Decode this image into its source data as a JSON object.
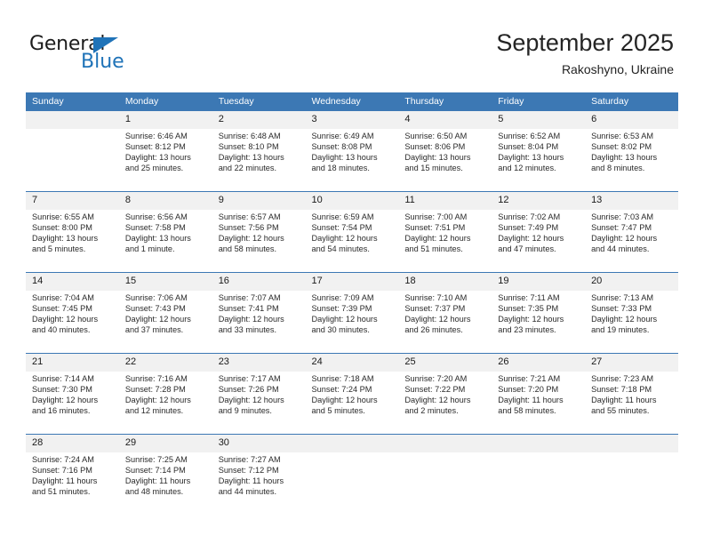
{
  "brand": {
    "name_dark": "General",
    "name_light": "Blue",
    "triangle_color": "#1f73b8",
    "logo_icon": "triangle-icon"
  },
  "header": {
    "title": "September 2025",
    "subtitle": "Rakoshyno, Ukraine",
    "accent_color": "#3c78b4",
    "num_band_color": "#f1f1f1"
  },
  "columns": [
    "Sunday",
    "Monday",
    "Tuesday",
    "Wednesday",
    "Thursday",
    "Friday",
    "Saturday"
  ],
  "weeks": [
    {
      "days": [
        {
          "num": "",
          "sunrise": "",
          "sunset": "",
          "daylight1": "",
          "daylight2": ""
        },
        {
          "num": "1",
          "sunrise": "Sunrise: 6:46 AM",
          "sunset": "Sunset: 8:12 PM",
          "daylight1": "Daylight: 13 hours",
          "daylight2": "and 25 minutes."
        },
        {
          "num": "2",
          "sunrise": "Sunrise: 6:48 AM",
          "sunset": "Sunset: 8:10 PM",
          "daylight1": "Daylight: 13 hours",
          "daylight2": "and 22 minutes."
        },
        {
          "num": "3",
          "sunrise": "Sunrise: 6:49 AM",
          "sunset": "Sunset: 8:08 PM",
          "daylight1": "Daylight: 13 hours",
          "daylight2": "and 18 minutes."
        },
        {
          "num": "4",
          "sunrise": "Sunrise: 6:50 AM",
          "sunset": "Sunset: 8:06 PM",
          "daylight1": "Daylight: 13 hours",
          "daylight2": "and 15 minutes."
        },
        {
          "num": "5",
          "sunrise": "Sunrise: 6:52 AM",
          "sunset": "Sunset: 8:04 PM",
          "daylight1": "Daylight: 13 hours",
          "daylight2": "and 12 minutes."
        },
        {
          "num": "6",
          "sunrise": "Sunrise: 6:53 AM",
          "sunset": "Sunset: 8:02 PM",
          "daylight1": "Daylight: 13 hours",
          "daylight2": "and 8 minutes."
        }
      ]
    },
    {
      "days": [
        {
          "num": "7",
          "sunrise": "Sunrise: 6:55 AM",
          "sunset": "Sunset: 8:00 PM",
          "daylight1": "Daylight: 13 hours",
          "daylight2": "and 5 minutes."
        },
        {
          "num": "8",
          "sunrise": "Sunrise: 6:56 AM",
          "sunset": "Sunset: 7:58 PM",
          "daylight1": "Daylight: 13 hours",
          "daylight2": "and 1 minute."
        },
        {
          "num": "9",
          "sunrise": "Sunrise: 6:57 AM",
          "sunset": "Sunset: 7:56 PM",
          "daylight1": "Daylight: 12 hours",
          "daylight2": "and 58 minutes."
        },
        {
          "num": "10",
          "sunrise": "Sunrise: 6:59 AM",
          "sunset": "Sunset: 7:54 PM",
          "daylight1": "Daylight: 12 hours",
          "daylight2": "and 54 minutes."
        },
        {
          "num": "11",
          "sunrise": "Sunrise: 7:00 AM",
          "sunset": "Sunset: 7:51 PM",
          "daylight1": "Daylight: 12 hours",
          "daylight2": "and 51 minutes."
        },
        {
          "num": "12",
          "sunrise": "Sunrise: 7:02 AM",
          "sunset": "Sunset: 7:49 PM",
          "daylight1": "Daylight: 12 hours",
          "daylight2": "and 47 minutes."
        },
        {
          "num": "13",
          "sunrise": "Sunrise: 7:03 AM",
          "sunset": "Sunset: 7:47 PM",
          "daylight1": "Daylight: 12 hours",
          "daylight2": "and 44 minutes."
        }
      ]
    },
    {
      "days": [
        {
          "num": "14",
          "sunrise": "Sunrise: 7:04 AM",
          "sunset": "Sunset: 7:45 PM",
          "daylight1": "Daylight: 12 hours",
          "daylight2": "and 40 minutes."
        },
        {
          "num": "15",
          "sunrise": "Sunrise: 7:06 AM",
          "sunset": "Sunset: 7:43 PM",
          "daylight1": "Daylight: 12 hours",
          "daylight2": "and 37 minutes."
        },
        {
          "num": "16",
          "sunrise": "Sunrise: 7:07 AM",
          "sunset": "Sunset: 7:41 PM",
          "daylight1": "Daylight: 12 hours",
          "daylight2": "and 33 minutes."
        },
        {
          "num": "17",
          "sunrise": "Sunrise: 7:09 AM",
          "sunset": "Sunset: 7:39 PM",
          "daylight1": "Daylight: 12 hours",
          "daylight2": "and 30 minutes."
        },
        {
          "num": "18",
          "sunrise": "Sunrise: 7:10 AM",
          "sunset": "Sunset: 7:37 PM",
          "daylight1": "Daylight: 12 hours",
          "daylight2": "and 26 minutes."
        },
        {
          "num": "19",
          "sunrise": "Sunrise: 7:11 AM",
          "sunset": "Sunset: 7:35 PM",
          "daylight1": "Daylight: 12 hours",
          "daylight2": "and 23 minutes."
        },
        {
          "num": "20",
          "sunrise": "Sunrise: 7:13 AM",
          "sunset": "Sunset: 7:33 PM",
          "daylight1": "Daylight: 12 hours",
          "daylight2": "and 19 minutes."
        }
      ]
    },
    {
      "days": [
        {
          "num": "21",
          "sunrise": "Sunrise: 7:14 AM",
          "sunset": "Sunset: 7:30 PM",
          "daylight1": "Daylight: 12 hours",
          "daylight2": "and 16 minutes."
        },
        {
          "num": "22",
          "sunrise": "Sunrise: 7:16 AM",
          "sunset": "Sunset: 7:28 PM",
          "daylight1": "Daylight: 12 hours",
          "daylight2": "and 12 minutes."
        },
        {
          "num": "23",
          "sunrise": "Sunrise: 7:17 AM",
          "sunset": "Sunset: 7:26 PM",
          "daylight1": "Daylight: 12 hours",
          "daylight2": "and 9 minutes."
        },
        {
          "num": "24",
          "sunrise": "Sunrise: 7:18 AM",
          "sunset": "Sunset: 7:24 PM",
          "daylight1": "Daylight: 12 hours",
          "daylight2": "and 5 minutes."
        },
        {
          "num": "25",
          "sunrise": "Sunrise: 7:20 AM",
          "sunset": "Sunset: 7:22 PM",
          "daylight1": "Daylight: 12 hours",
          "daylight2": "and 2 minutes."
        },
        {
          "num": "26",
          "sunrise": "Sunrise: 7:21 AM",
          "sunset": "Sunset: 7:20 PM",
          "daylight1": "Daylight: 11 hours",
          "daylight2": "and 58 minutes."
        },
        {
          "num": "27",
          "sunrise": "Sunrise: 7:23 AM",
          "sunset": "Sunset: 7:18 PM",
          "daylight1": "Daylight: 11 hours",
          "daylight2": "and 55 minutes."
        }
      ]
    },
    {
      "days": [
        {
          "num": "28",
          "sunrise": "Sunrise: 7:24 AM",
          "sunset": "Sunset: 7:16 PM",
          "daylight1": "Daylight: 11 hours",
          "daylight2": "and 51 minutes."
        },
        {
          "num": "29",
          "sunrise": "Sunrise: 7:25 AM",
          "sunset": "Sunset: 7:14 PM",
          "daylight1": "Daylight: 11 hours",
          "daylight2": "and 48 minutes."
        },
        {
          "num": "30",
          "sunrise": "Sunrise: 7:27 AM",
          "sunset": "Sunset: 7:12 PM",
          "daylight1": "Daylight: 11 hours",
          "daylight2": "and 44 minutes."
        },
        {
          "num": "",
          "sunrise": "",
          "sunset": "",
          "daylight1": "",
          "daylight2": ""
        },
        {
          "num": "",
          "sunrise": "",
          "sunset": "",
          "daylight1": "",
          "daylight2": ""
        },
        {
          "num": "",
          "sunrise": "",
          "sunset": "",
          "daylight1": "",
          "daylight2": ""
        },
        {
          "num": "",
          "sunrise": "",
          "sunset": "",
          "daylight1": "",
          "daylight2": ""
        }
      ]
    }
  ]
}
